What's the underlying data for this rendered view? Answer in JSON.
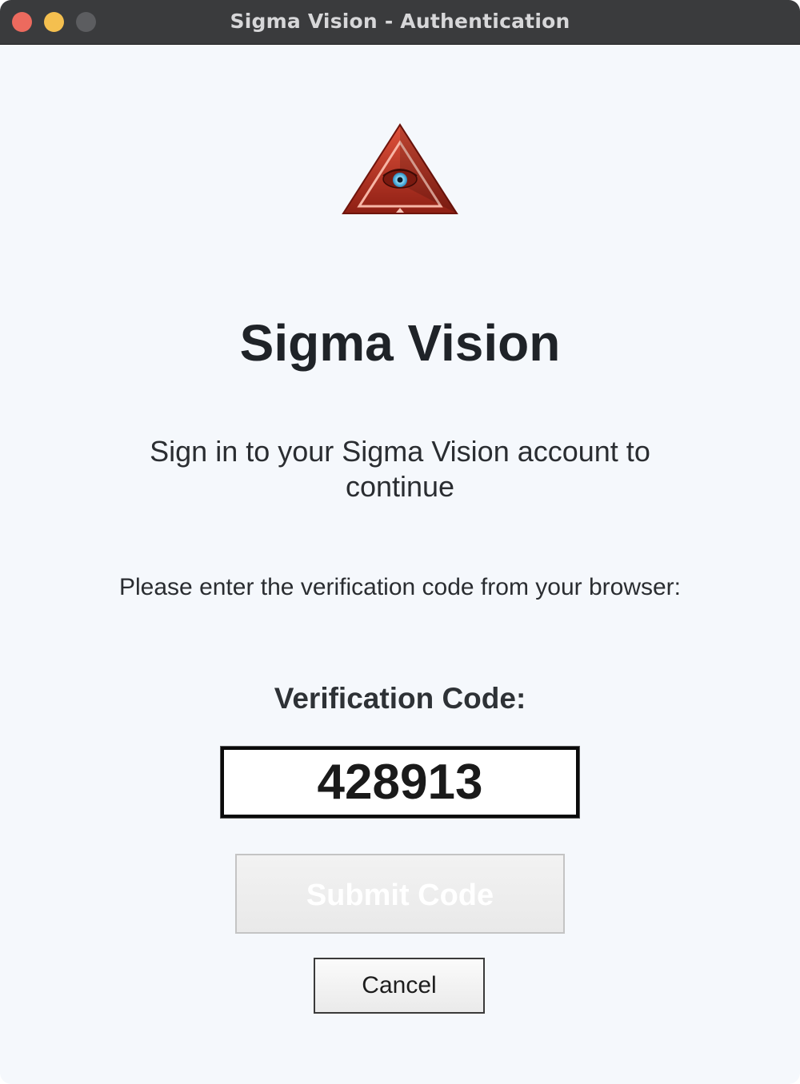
{
  "window": {
    "title": "Sigma Vision - Authentication"
  },
  "app": {
    "logo_icon": "eye-pyramid-logo",
    "name": "Sigma Vision",
    "subtitle": "Sign in to your Sigma Vision account to continue"
  },
  "form": {
    "instructions": "Please enter the verification code from your browser:",
    "code_label": "Verification Code:",
    "code_value": "428913",
    "submit_label": "Submit Code",
    "cancel_label": "Cancel"
  },
  "colors": {
    "titlebar": "#3a3b3d",
    "background": "#f5f8fc",
    "close": "#ec6a5e",
    "minimize": "#f4bf4f",
    "logo_red": "#c0392b"
  }
}
